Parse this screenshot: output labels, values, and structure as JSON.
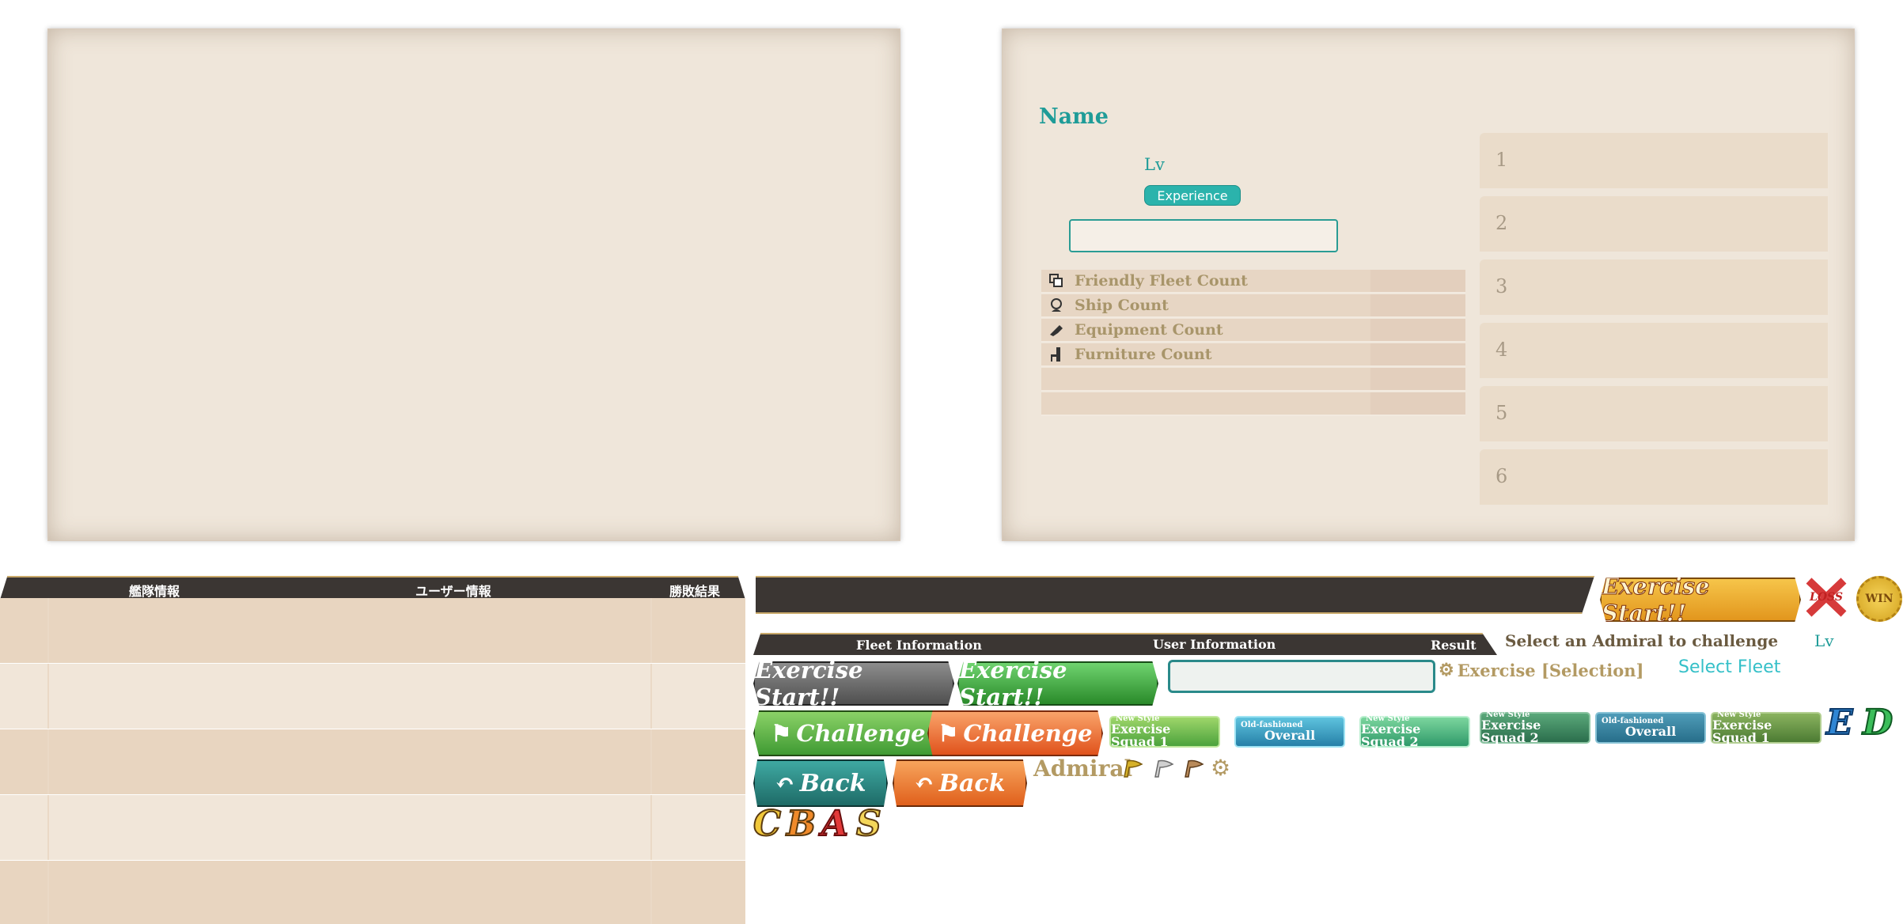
{
  "profile": {
    "name_label": "Name",
    "lv_label": "Lv",
    "experience_label": "Experience",
    "stats": [
      "Friendly Fleet Count",
      "Ship Count",
      "Equipment Count",
      "Furniture Count",
      "",
      ""
    ],
    "slots": [
      "1",
      "2",
      "3",
      "4",
      "5",
      "6"
    ]
  },
  "table_jp": {
    "headers": [
      "艦隊情報",
      "ユーザー情報",
      "勝敗結果"
    ]
  },
  "table_en": {
    "headers": [
      "Fleet Information",
      "User Information",
      "Result"
    ]
  },
  "texts": {
    "select_admiral": "Select an Admiral to challenge",
    "lv": "Lv",
    "exercise_selection": "Exercise [Selection]",
    "select_fleet": "Select Fleet",
    "admiral": "Admiral"
  },
  "buttons": {
    "exercise_start": "Exercise Start!!",
    "challenge": "Challenge",
    "back": "Back"
  },
  "badges": {
    "loss": "LOSS",
    "win": "WIN"
  },
  "tabs": [
    {
      "small": "New Style",
      "label": "Exercise Squad 1"
    },
    {
      "small": "Old-fashioned",
      "label": "Overall"
    },
    {
      "small": "New Style",
      "label": "Exercise Squad 2"
    },
    {
      "small": "New Style",
      "label": "Exercise Squad 2"
    },
    {
      "small": "Old-fashioned",
      "label": "Overall"
    },
    {
      "small": "New Style",
      "label": "Exercise Squad 1"
    }
  ],
  "ranks": [
    "E",
    "D",
    "C",
    "B",
    "A",
    "S"
  ],
  "colors": {
    "teal": "#1f9c98",
    "gold": "#b39a63",
    "paper": "#efe6da",
    "dark_bar": "#3b3633"
  }
}
